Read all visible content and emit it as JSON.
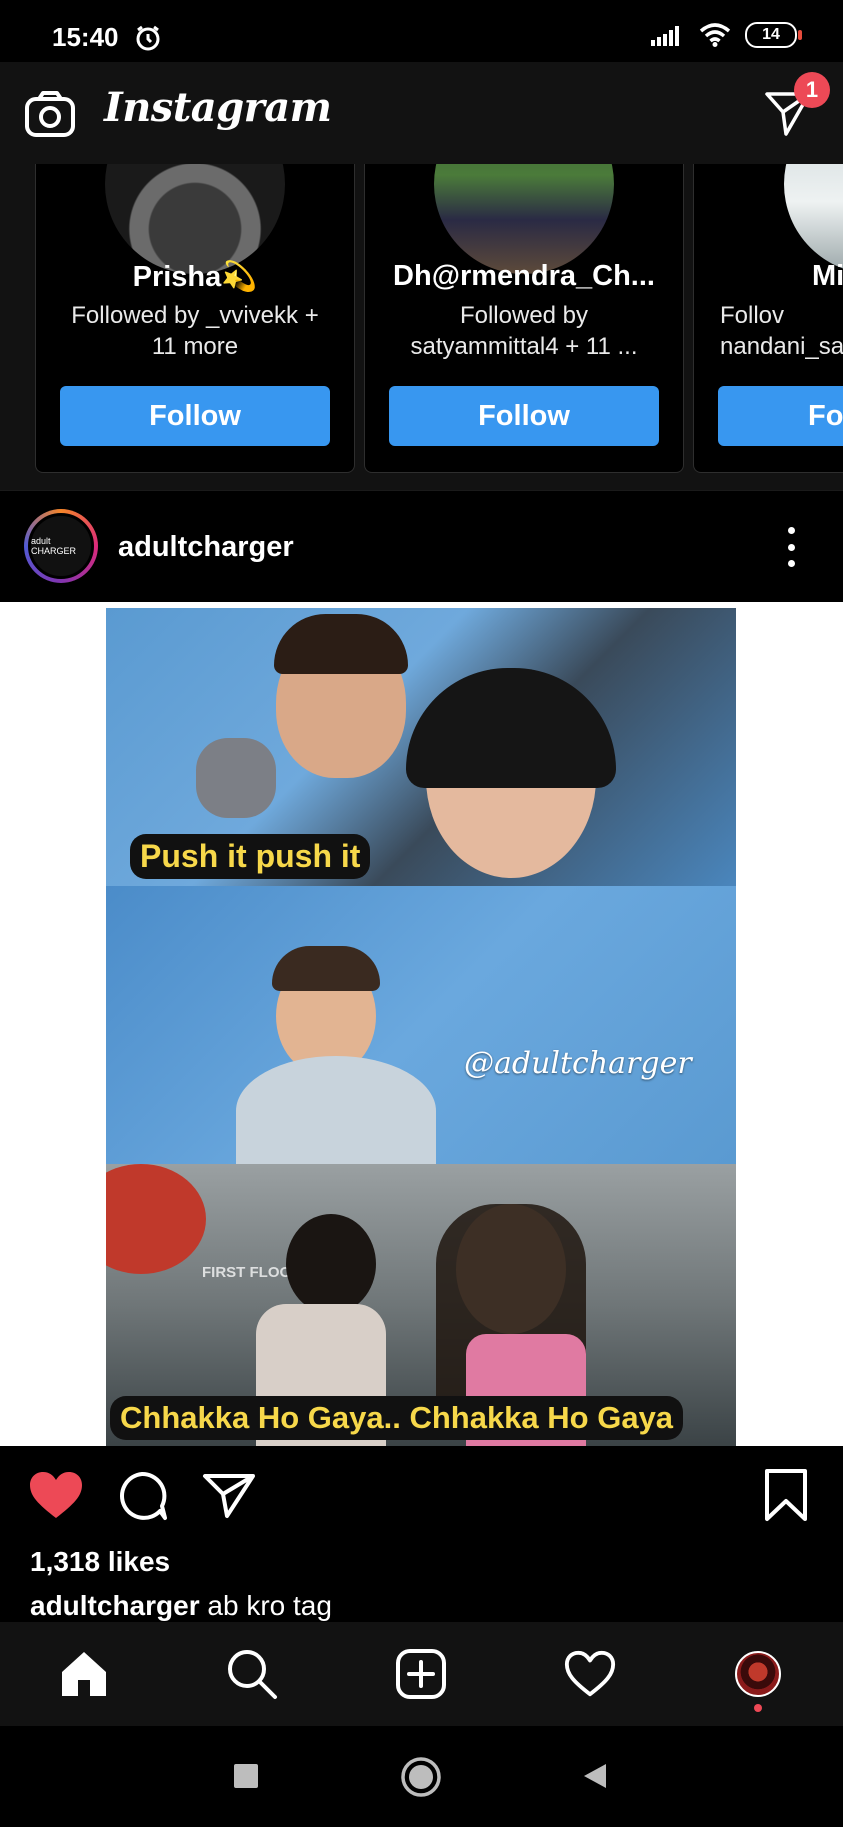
{
  "status_bar": {
    "time": "15:40",
    "battery": "14"
  },
  "header": {
    "app_title": "Instagram",
    "dm_badge_count": "1",
    "icons": [
      "camera-icon",
      "direct-message-icon"
    ]
  },
  "suggestions": [
    {
      "name": "Prisha💫",
      "followed_by": "Followed by _vvivekk + 11 more",
      "button": "Follow"
    },
    {
      "name": "Dh@rmendra_Ch...",
      "followed_by": "Followed by satyammittal4 + 11 ...",
      "button": "Follow"
    },
    {
      "name": "Mi",
      "followed_by": "Follov nandani_sa",
      "button": "Fo"
    }
  ],
  "post": {
    "username": "adultcharger",
    "avatar_text": "adult CHARGER",
    "meme": {
      "top_caption": "Push it push it",
      "watermark": "@adultcharger",
      "sign_text": "FIRST FLOOR",
      "bottom_caption": "Chhakka Ho Gaya.. Chhakka Ho Gaya"
    },
    "liked": true,
    "likes": "1,318 likes",
    "caption_user": "adultcharger",
    "caption_text": "ab kro tag"
  },
  "bottom_nav": {
    "items": [
      "home-icon",
      "search-icon",
      "new-post-icon",
      "activity-icon",
      "profile-icon"
    ],
    "active": "home"
  },
  "colors": {
    "follow_blue": "#3897f0",
    "like_red": "#ed4956",
    "caption_yellow": "#f7d84a",
    "scrub_blue": "#5a9ad1"
  }
}
